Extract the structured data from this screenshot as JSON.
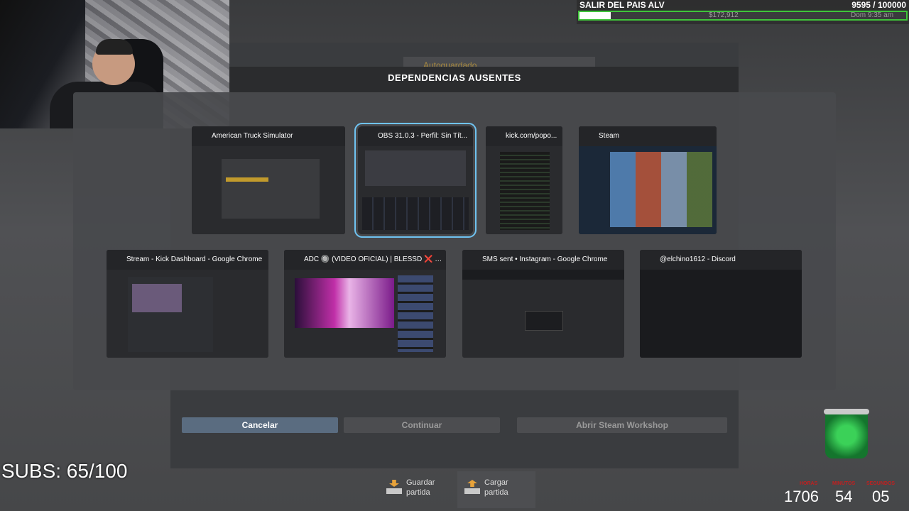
{
  "background": {
    "panel_title": "DEPENDENCIAS AUSENTES",
    "autosave_label": "Autoguardado"
  },
  "objective": {
    "title": "SALIR DEL PAIS ALV",
    "count": "9595 / 100000",
    "progress": 0.096,
    "money": "$172,912",
    "time": "Dom 9:35 am",
    "bar_color": "#3fc43a"
  },
  "windows": [
    {
      "title": "American Truck Simulator",
      "icon": "ats-icon",
      "icon_color": "#b8623a",
      "selected": false
    },
    {
      "title": "OBS 31.0.3 - Perfil: Sin Tít...",
      "icon": "obs-icon",
      "icon_color": "#2a2a2a",
      "selected": true
    },
    {
      "title": "kick.com/popo...",
      "icon": "kick-icon",
      "icon_color": "#53fc18",
      "selected": false
    },
    {
      "title": "Steam",
      "icon": "steam-icon",
      "icon_color": "#1b2838",
      "selected": false
    },
    {
      "title": "Stream - Kick Dashboard - Google Chrome",
      "icon": "chrome-icon",
      "icon_color": "#e6463c",
      "selected": false
    },
    {
      "title": "ADC 🔘 (VIDEO OFICIAL) | BLESSD ❌ RYA...",
      "icon": "brave-icon",
      "icon_color": "#e0533a",
      "selected": false
    },
    {
      "title": "SMS sent • Instagram - Google Chrome",
      "icon": "chrome-icon",
      "icon_color": "#e6463c",
      "selected": false
    },
    {
      "title": "@elchino1612 - Discord",
      "icon": "discord-icon",
      "icon_color": "#5865f2",
      "selected": false
    }
  ],
  "buttons": {
    "cancel": "Cancelar",
    "continue": "Continuar",
    "workshop": "Abrir Steam Workshop"
  },
  "subs": "SUBS: 65/100",
  "bottom_bar": {
    "save_line1": "Guardar",
    "save_line2": "partida",
    "load_line1": "Cargar",
    "load_line2": "partida"
  },
  "timer": {
    "label_hours": "HORAS",
    "label_minutes": "MINUTOS",
    "label_seconds": "SEGUNDOS",
    "hours": "1706",
    "minutes": "54",
    "seconds": "05"
  }
}
